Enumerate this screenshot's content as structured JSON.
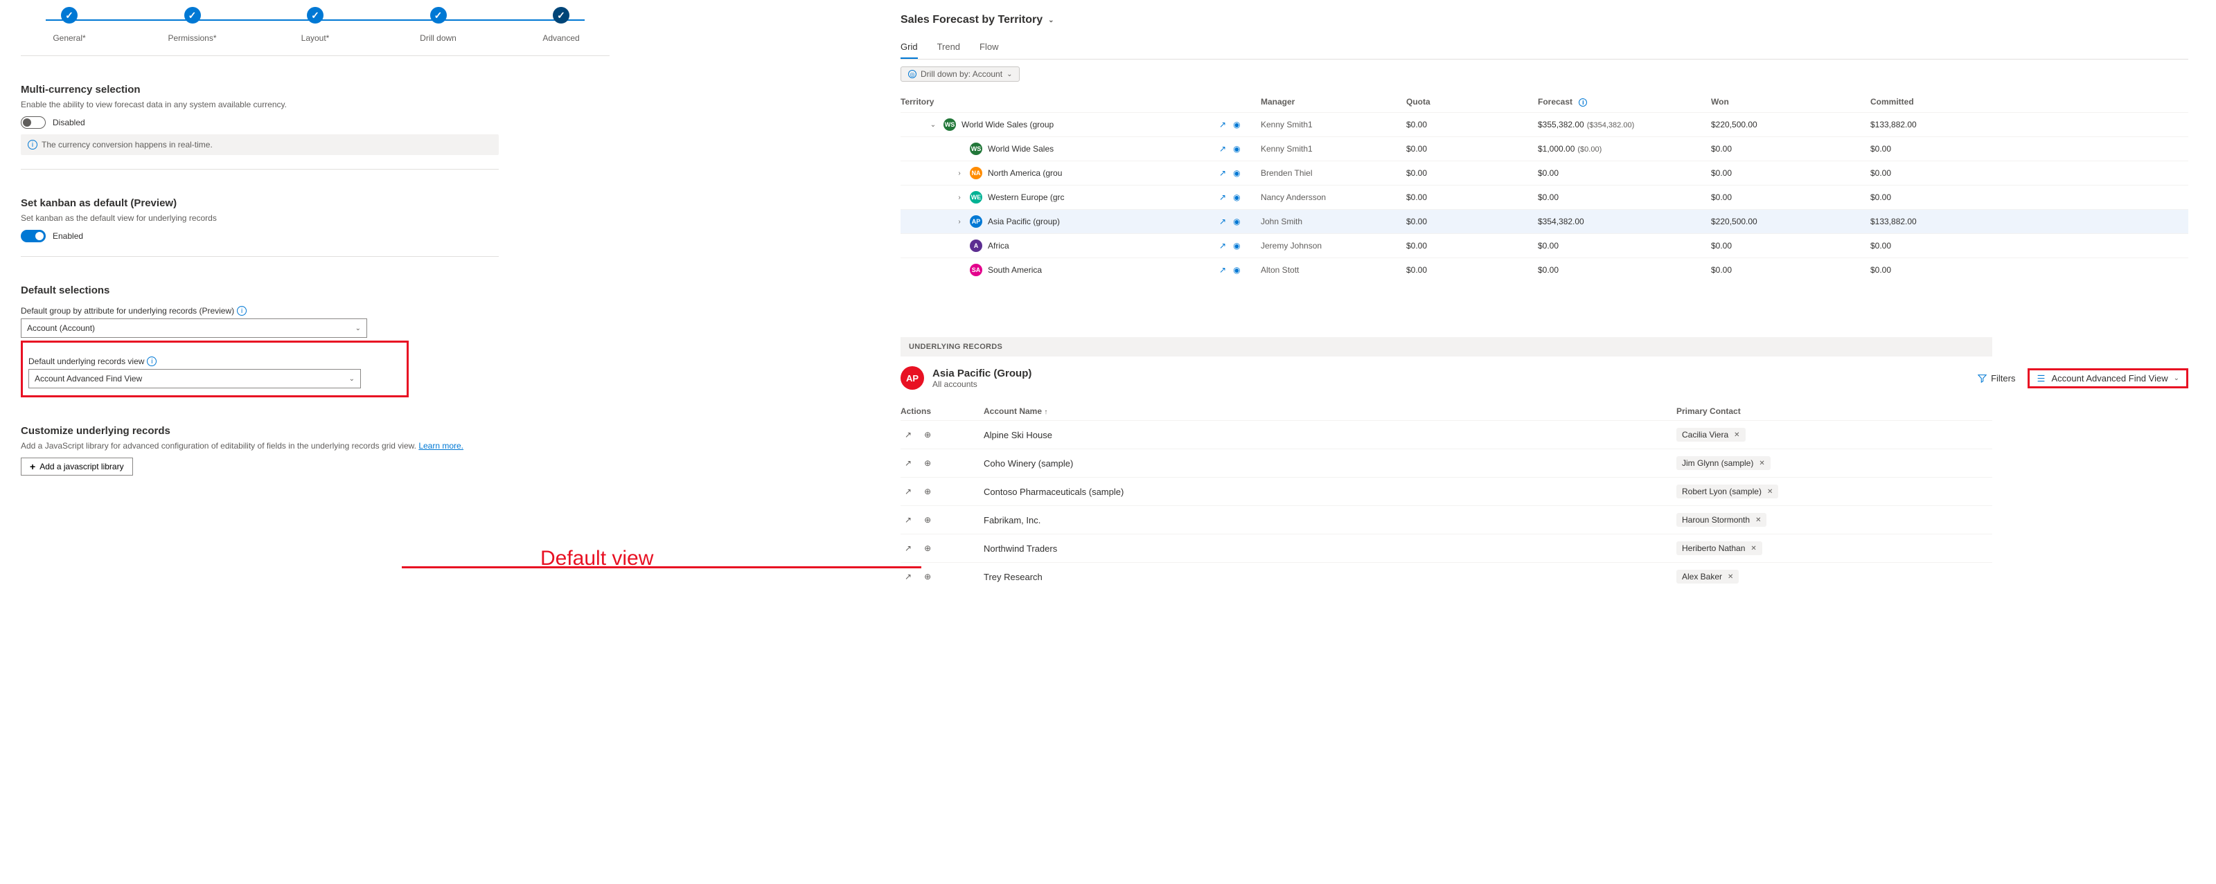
{
  "stepper": {
    "s1": "General*",
    "s2": "Permissions*",
    "s3": "Layout*",
    "s4": "Drill down",
    "s5": "Advanced"
  },
  "multi": {
    "title": "Multi-currency selection",
    "sub": "Enable the ability to view forecast data in any system available currency.",
    "state": "Disabled",
    "banner": "The currency conversion happens in real-time."
  },
  "kanban": {
    "title": "Set kanban as default (Preview)",
    "sub": "Set kanban as the default view for underlying records",
    "state": "Enabled"
  },
  "defaults": {
    "title": "Default selections",
    "groupLabel": "Default group by attribute for underlying records (Preview)",
    "groupValue": "Account (Account)",
    "viewLabel": "Default underlying records view",
    "viewValue": "Account Advanced Find View"
  },
  "custom": {
    "title": "Customize underlying records",
    "sub1": "Add a JavaScript library for advanced configuration of editability of fields in the underlying records grid view. ",
    "learn": "Learn more.",
    "btn": "Add a javascript library"
  },
  "annot": "Default view",
  "forecast": {
    "title": "Sales Forecast by Territory",
    "tabs": {
      "grid": "Grid",
      "trend": "Trend",
      "flow": "Flow"
    },
    "drill": "Drill down by: Account",
    "cols": {
      "territory": "Territory",
      "manager": "Manager",
      "quota": "Quota",
      "forecast": "Forecast",
      "won": "Won",
      "committed": "Committed"
    },
    "rows": [
      {
        "cls": "ws",
        "ab": "WS",
        "name": "World Wide Sales (group",
        "mgr": "Kenny Smith1",
        "quota": "$0.00",
        "fc": "$355,382.00",
        "fc2": "($354,382.00)",
        "won": "$220,500.00",
        "com": "$133,882.00",
        "exp": "v",
        "ind": "indent1"
      },
      {
        "cls": "ws",
        "ab": "WS",
        "name": "World Wide Sales",
        "mgr": "Kenny Smith1",
        "quota": "$0.00",
        "fc": "$1,000.00",
        "fc2": "($0.00)",
        "won": "$0.00",
        "com": "$0.00",
        "exp": "",
        "ind": "indent2"
      },
      {
        "cls": "na",
        "ab": "NA",
        "name": "North America (grou",
        "mgr": "Brenden Thiel",
        "quota": "$0.00",
        "fc": "$0.00",
        "fc2": "",
        "won": "$0.00",
        "com": "$0.00",
        "exp": ">",
        "ind": "indent2"
      },
      {
        "cls": "we",
        "ab": "WE",
        "name": "Western Europe (grc",
        "mgr": "Nancy Andersson",
        "quota": "$0.00",
        "fc": "$0.00",
        "fc2": "",
        "won": "$0.00",
        "com": "$0.00",
        "exp": ">",
        "ind": "indent2"
      },
      {
        "cls": "ap",
        "ab": "AP",
        "name": "Asia Pacific (group)",
        "mgr": "John Smith",
        "quota": "$0.00",
        "fc": "$354,382.00",
        "fc2": "",
        "won": "$220,500.00",
        "com": "$133,882.00",
        "exp": ">",
        "ind": "indent2",
        "hl": true
      },
      {
        "cls": "af",
        "ab": "A",
        "name": "Africa",
        "mgr": "Jeremy Johnson",
        "quota": "$0.00",
        "fc": "$0.00",
        "fc2": "",
        "won": "$0.00",
        "com": "$0.00",
        "exp": "",
        "ind": "indent2"
      },
      {
        "cls": "sa",
        "ab": "SA",
        "name": "South America",
        "mgr": "Alton Stott",
        "quota": "$0.00",
        "fc": "$0.00",
        "fc2": "",
        "won": "$0.00",
        "com": "$0.00",
        "exp": "",
        "ind": "indent2"
      }
    ]
  },
  "under": {
    "banner": "UNDERLYING RECORDS",
    "avatar": "AP",
    "title": "Asia Pacific (Group)",
    "sub": "All accounts",
    "filters": "Filters",
    "view": "Account Advanced Find View",
    "cols": {
      "actions": "Actions",
      "name": "Account Name",
      "contact": "Primary Contact"
    },
    "rows": [
      {
        "name": "Alpine Ski House",
        "contact": "Cacilia Viera"
      },
      {
        "name": "Coho Winery (sample)",
        "contact": "Jim Glynn (sample)"
      },
      {
        "name": "Contoso Pharmaceuticals (sample)",
        "contact": "Robert Lyon (sample)"
      },
      {
        "name": "Fabrikam, Inc.",
        "contact": "Haroun Stormonth"
      },
      {
        "name": "Northwind Traders",
        "contact": "Heriberto Nathan"
      },
      {
        "name": "Trey Research",
        "contact": "Alex Baker"
      }
    ]
  }
}
